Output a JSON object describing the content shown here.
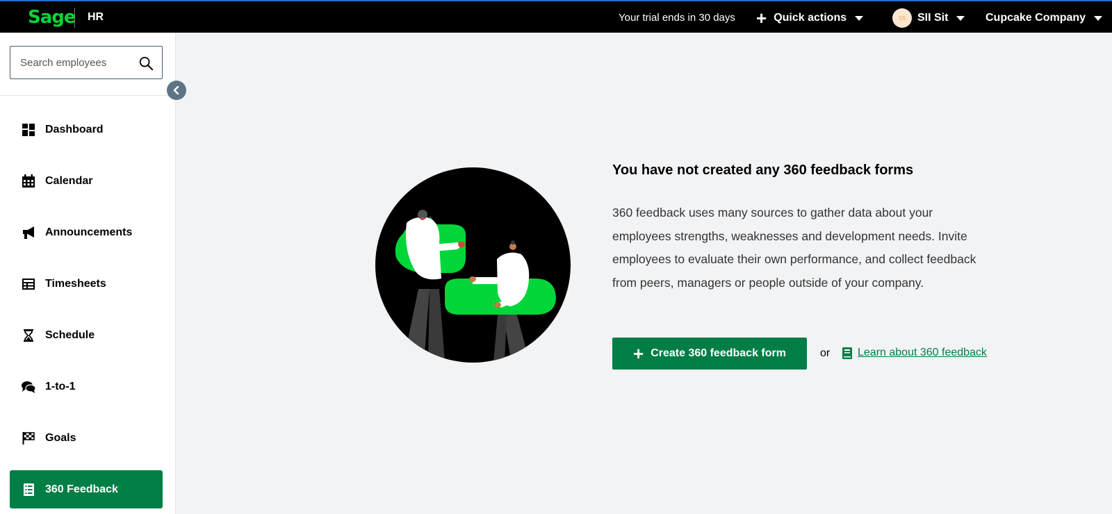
{
  "app": {
    "logo": "Sage",
    "product": "HR"
  },
  "topbar": {
    "trial": "Your trial ends in 30 days",
    "quick_actions": "Quick actions",
    "user_name": "SII Sit",
    "user_initials": "SS",
    "company": "Cupcake Company"
  },
  "sidebar": {
    "search_placeholder": "Search employees",
    "items": [
      {
        "label": "Dashboard",
        "icon": "dashboard-icon"
      },
      {
        "label": "Calendar",
        "icon": "calendar-icon"
      },
      {
        "label": "Announcements",
        "icon": "megaphone-icon"
      },
      {
        "label": "Timesheets",
        "icon": "table-icon"
      },
      {
        "label": "Schedule",
        "icon": "hourglass-icon"
      },
      {
        "label": "1-to-1",
        "icon": "chat-icon"
      },
      {
        "label": "Goals",
        "icon": "checkered-flag-icon"
      },
      {
        "label": "360 Feedback",
        "icon": "form-list-icon",
        "active": true
      }
    ]
  },
  "main": {
    "heading": "You have not created any 360 feedback forms",
    "description": "360 feedback uses many sources to gather data about your employees strengths, weaknesses and development needs. Invite employees to evaluate their own performance, and collect feedback from peers, managers or people outside of your company.",
    "create_button": "Create 360 feedback form",
    "or": "or",
    "learn_link": "Learn about 360 feedback"
  },
  "colors": {
    "brand_green": "#007e45",
    "logo_green": "#00d639",
    "topbar": "#000000",
    "background": "#f2f3f5"
  }
}
